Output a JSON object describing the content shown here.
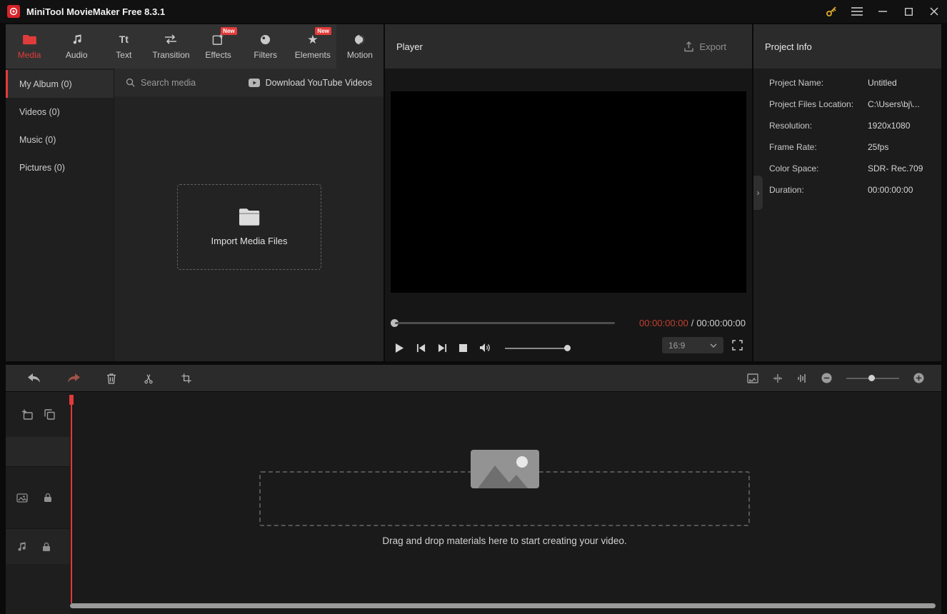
{
  "colors": {
    "accent_red": "#e23b3b",
    "time_current_red": "#c2402f",
    "key_gold": "#dba62b"
  },
  "titlebar": {
    "app_title": "MiniTool MovieMaker Free 8.3.1"
  },
  "ribbon_tabs": [
    {
      "label": "Media"
    },
    {
      "label": "Audio"
    },
    {
      "label": "Text"
    },
    {
      "label": "Transition"
    },
    {
      "label": "Effects",
      "badge": "New"
    },
    {
      "label": "Filters"
    },
    {
      "label": "Elements",
      "badge": "New"
    },
    {
      "label": "Motion"
    }
  ],
  "library_sidebar": {
    "items": [
      {
        "label": "My Album (0)"
      },
      {
        "label": "Videos (0)"
      },
      {
        "label": "Music (0)"
      },
      {
        "label": "Pictures (0)"
      }
    ]
  },
  "media_panel": {
    "search_placeholder": "Search media",
    "download_youtube_label": "Download YouTube Videos",
    "import_label": "Import Media Files"
  },
  "player": {
    "title": "Player",
    "export_label": "Export",
    "current_time": "00:00:00:00",
    "time_separator": "/",
    "total_time": "00:00:00:00",
    "aspect_ratio": "16:9"
  },
  "project_info": {
    "title": "Project Info",
    "rows": [
      {
        "label": "Project Name:",
        "value": "Untitled"
      },
      {
        "label": "Project Files Location:",
        "value": "C:\\Users\\bj\\..."
      },
      {
        "label": "Resolution:",
        "value": "1920x1080"
      },
      {
        "label": "Frame Rate:",
        "value": "25fps"
      },
      {
        "label": "Color Space:",
        "value": "SDR- Rec.709"
      },
      {
        "label": "Duration:",
        "value": "00:00:00:00"
      }
    ]
  },
  "timeline": {
    "drop_hint": "Drag and drop materials here to start creating your video."
  },
  "icons": {
    "text_tab_glyph": "Tt",
    "star_glyph": "★",
    "collapse_chevron": "›"
  }
}
